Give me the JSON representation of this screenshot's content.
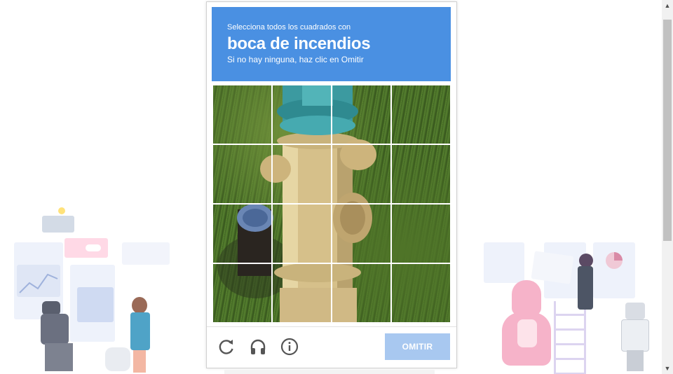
{
  "challenge": {
    "instruction_prefix": "Selecciona todos los cuadrados con",
    "target": "boca de incendios",
    "instruction_suffix": "Si no hay ninguna, haz clic en Omitir"
  },
  "grid": {
    "rows": 4,
    "cols": 4
  },
  "controls": {
    "reload_icon": "reload-icon",
    "audio_icon": "headphones-icon",
    "info_icon": "info-icon",
    "skip_label": "OMITIR"
  },
  "colors": {
    "header": "#4a90e2",
    "skip_button": "#a8c8f0"
  }
}
